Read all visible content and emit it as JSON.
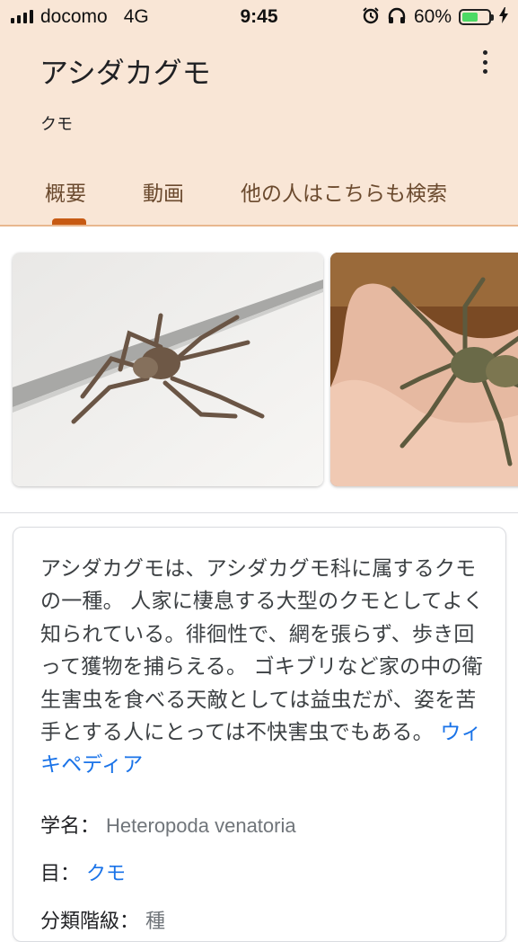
{
  "status": {
    "carrier": "docomo",
    "network": "4G",
    "time": "9:45",
    "battery_percent": "60%",
    "battery_level": 0.6,
    "icons": [
      "signal-icon",
      "alarm-icon",
      "headphones-icon",
      "battery-icon",
      "charging-icon"
    ]
  },
  "header": {
    "title": "アシダカグモ",
    "subtitle": "クモ",
    "tabs": [
      {
        "label": "概要",
        "active": true
      },
      {
        "label": "動画",
        "active": false
      },
      {
        "label": "他の人はこちらも検索",
        "active": false
      }
    ],
    "menu_icon": "more-vert-icon"
  },
  "images": [
    {
      "description_icon": "spider-on-wall-image"
    },
    {
      "description_icon": "spider-on-hand-image"
    }
  ],
  "card": {
    "description": "アシダカグモは、アシダカグモ科に属するクモの一種。 人家に棲息する大型のクモとしてよく知られている。徘徊性で、網を張らず、歩き回って獲物を捕らえる。 ゴキブリなど家の中の衛生害虫を食べる天敵としては益虫だが、姿を苦手とする人にとっては不快害虫でもある。",
    "source_link": "ウィキペディア",
    "facts": [
      {
        "label": "学名：",
        "value": "Heteropoda venatoria",
        "is_link": false
      },
      {
        "label": "目：",
        "value": "クモ",
        "is_link": true
      },
      {
        "label": "分類階級：",
        "value": "種",
        "is_link": false
      }
    ]
  },
  "colors": {
    "header_bg": "#f9e6d6",
    "tab_text": "#6b4a2e",
    "tab_indicator": "#c75a13",
    "link": "#1a73e8"
  }
}
